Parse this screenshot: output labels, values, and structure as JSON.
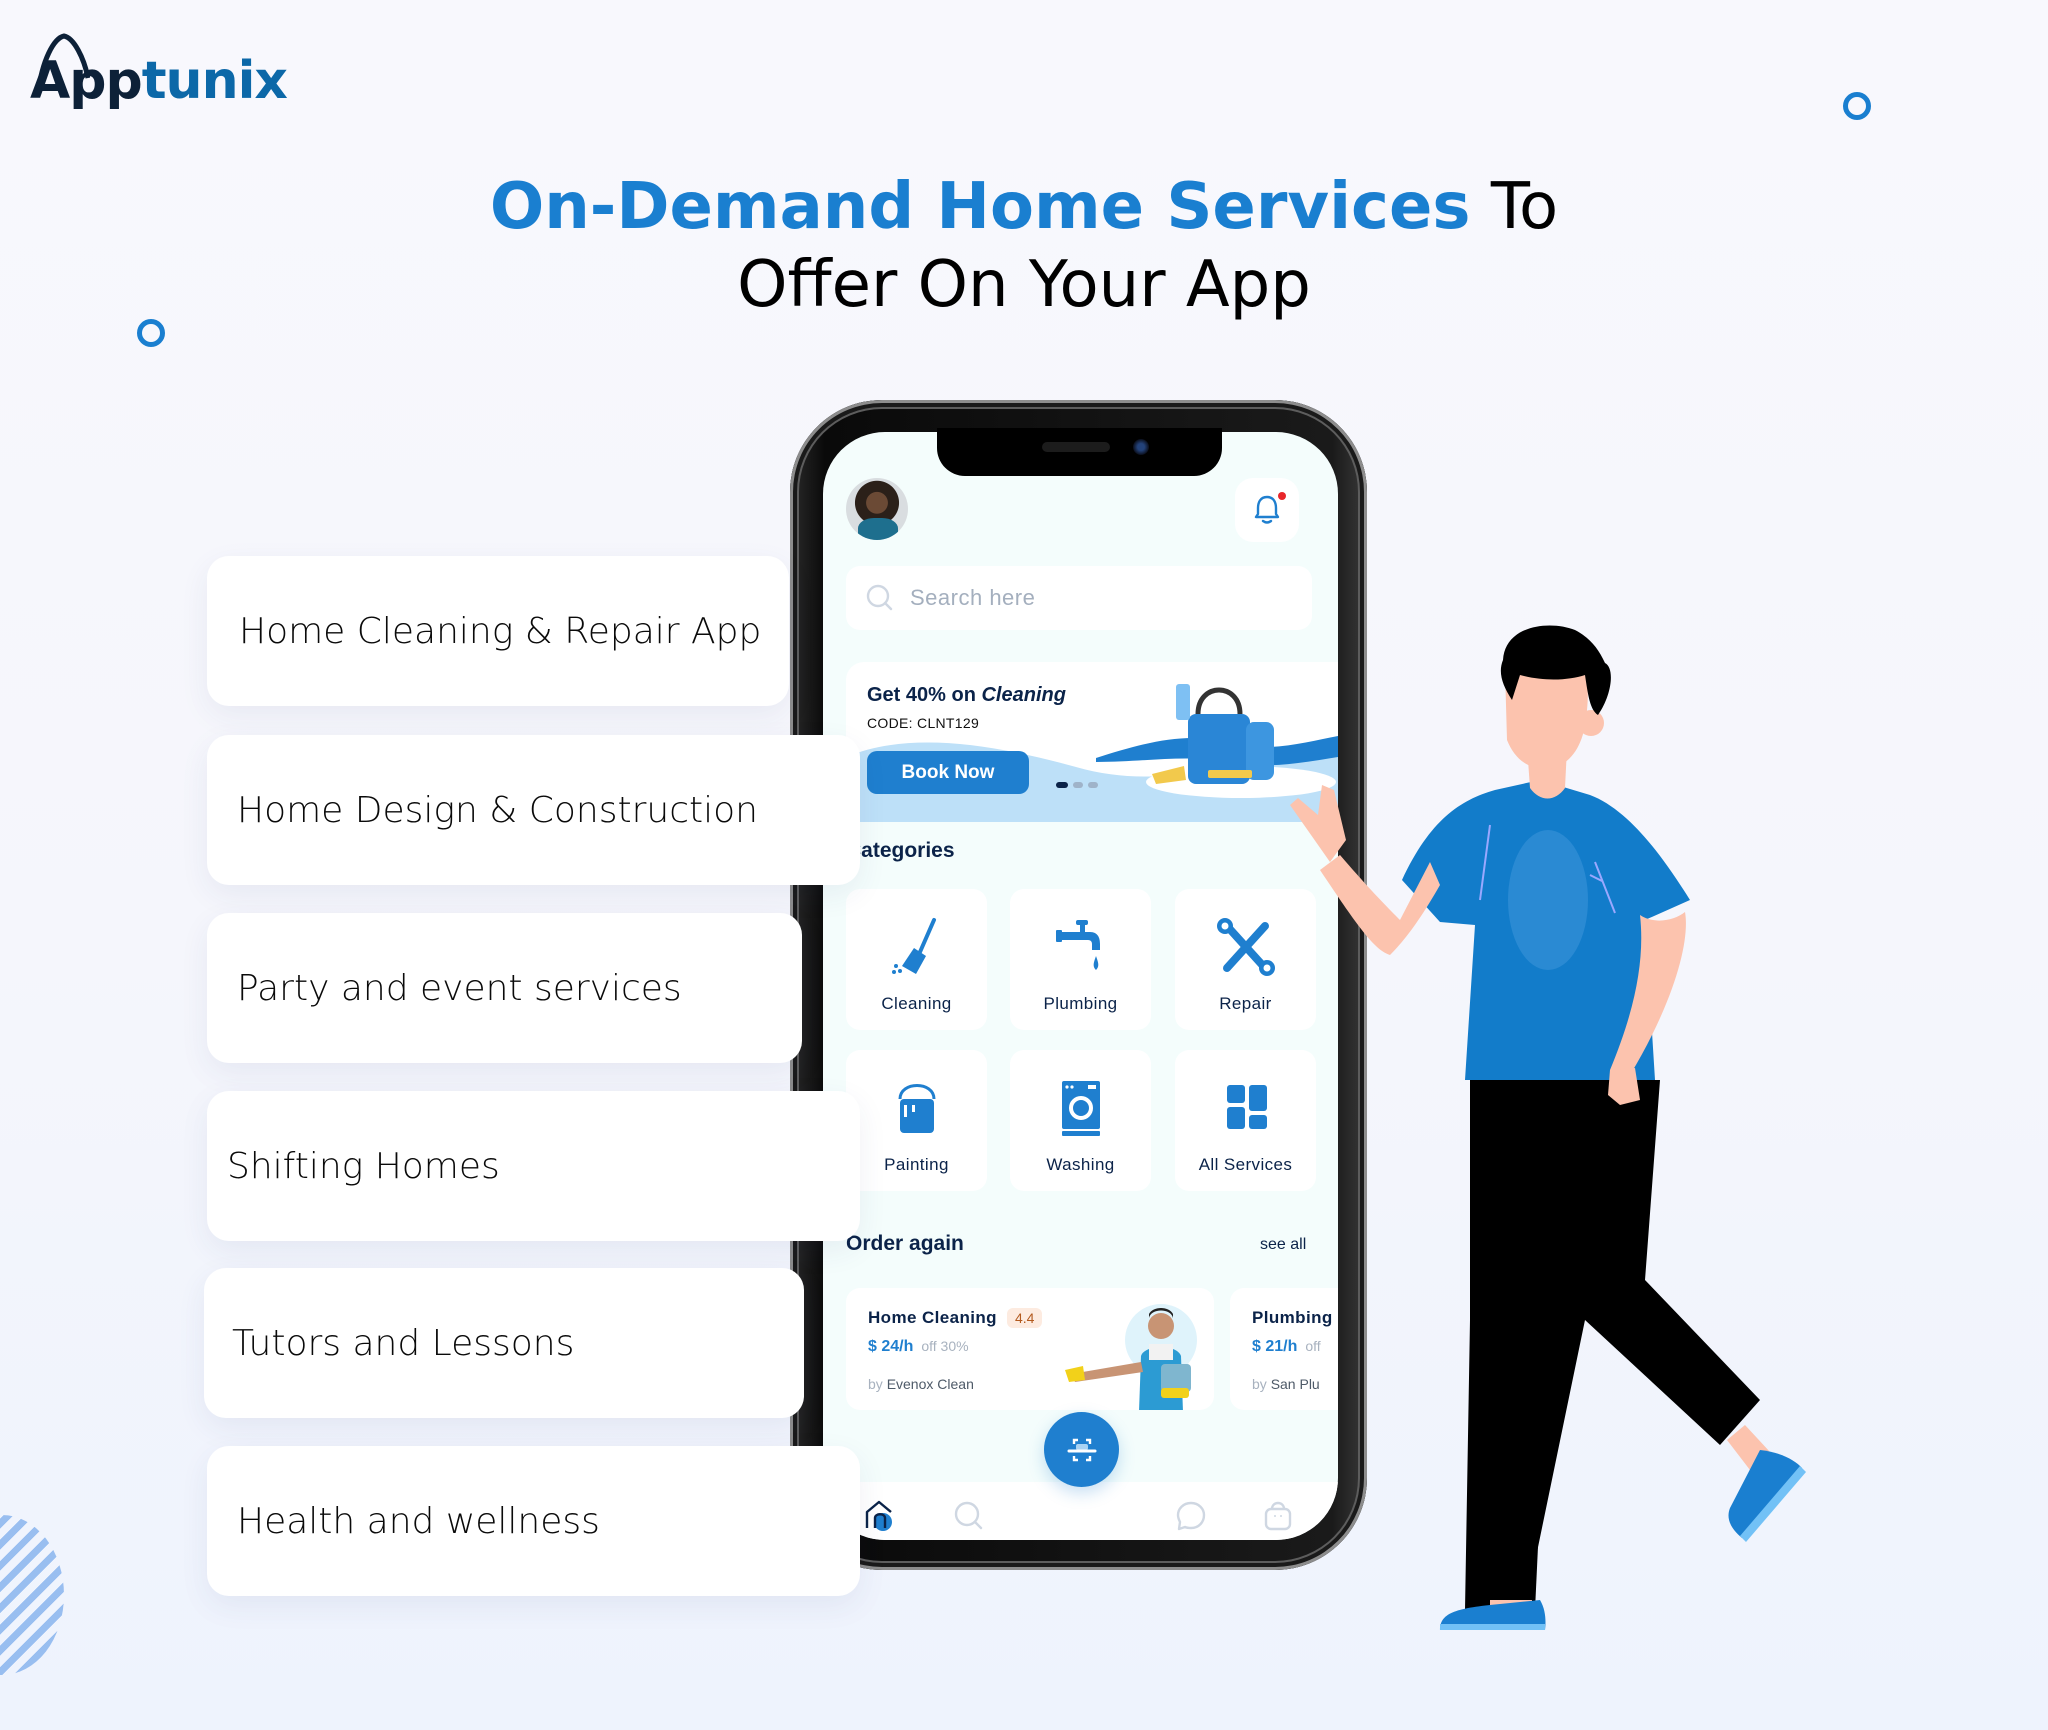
{
  "brand": {
    "logo_part1": "App",
    "logo_part2": "tunix",
    "colors": {
      "primary_blue": "#1a7fd0",
      "logo_dark": "#0d2138",
      "logo_blue": "#0c68a8",
      "navy": "#0b2349"
    }
  },
  "header": {
    "title_highlight": "On-Demand Home Services",
    "title_rest_line1": " To",
    "title_line2": "Offer On Your App"
  },
  "services": [
    {
      "label": "Home Cleaning & Repair App"
    },
    {
      "label": "Home Design & Construction"
    },
    {
      "label": "Party and event services"
    },
    {
      "label": "Shifting Homes"
    },
    {
      "label": "Tutors and Lessons"
    },
    {
      "label": "Health and wellness"
    }
  ],
  "app": {
    "avatar_icon": "user-avatar",
    "notification_icon": "bell-icon",
    "notification_badge": true,
    "search": {
      "placeholder": "Search here",
      "icon": "search-icon"
    },
    "promo": {
      "title_prefix": "Get 40% on ",
      "title_emphasis": "Cleaning",
      "code": "CODE: CLNT129",
      "button": "Book Now",
      "carousel_pages": 3,
      "carousel_active": 1
    },
    "categories_heading": "Categories",
    "categories": [
      {
        "label": "Cleaning",
        "icon": "broom-icon"
      },
      {
        "label": "Plumbing",
        "icon": "faucet-icon"
      },
      {
        "label": "Repair",
        "icon": "tools-icon"
      },
      {
        "label": "Painting",
        "icon": "paint-bucket-icon"
      },
      {
        "label": "Washing",
        "icon": "washing-machine-icon"
      },
      {
        "label": "All Services",
        "icon": "grid-icon"
      }
    ],
    "order_again": {
      "heading": "Order again",
      "see_all": "see all",
      "items": [
        {
          "title": "Home Cleaning",
          "rating": "4.4",
          "price": "$ 24/h",
          "discount": "off 30%",
          "by_prefix": "by",
          "provider": "Evenox Clean"
        },
        {
          "title": "Plumbing",
          "rating": "",
          "price": "$ 21/h",
          "discount": "off",
          "by_prefix": "by",
          "provider": "San Plu"
        }
      ]
    },
    "tabbar": [
      {
        "name": "home",
        "icon": "home-icon",
        "active": true
      },
      {
        "name": "search",
        "icon": "search-icon"
      },
      {
        "name": "scan",
        "icon": "scan-icon"
      },
      {
        "name": "chat",
        "icon": "chat-icon"
      },
      {
        "name": "bag",
        "icon": "shopping-bag-icon"
      }
    ]
  }
}
